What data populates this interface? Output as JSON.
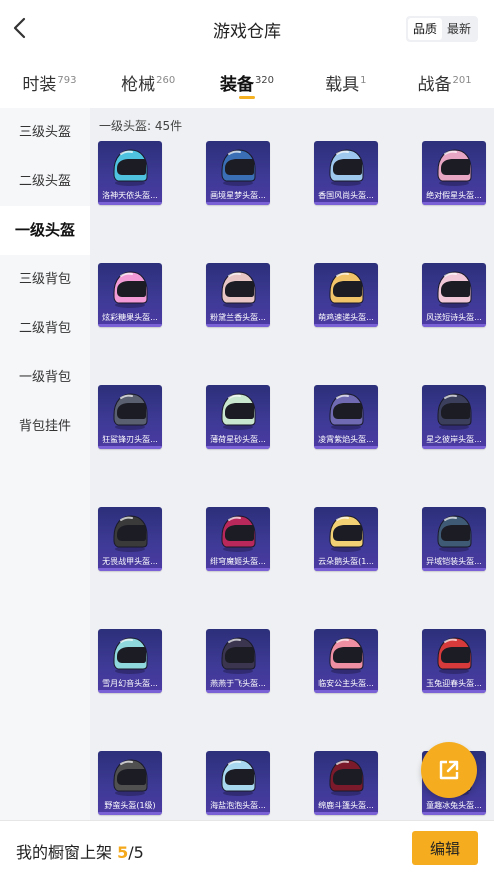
{
  "header": {
    "title": "游戏仓库",
    "sort_options": [
      "品质",
      "最新"
    ],
    "active_sort": "品质"
  },
  "tabs": [
    {
      "label": "时装",
      "count": "793"
    },
    {
      "label": "枪械",
      "count": "260"
    },
    {
      "label": "装备",
      "count": "320"
    },
    {
      "label": "载具",
      "count": "1"
    },
    {
      "label": "战备",
      "count": "201"
    }
  ],
  "sidebar": {
    "items": [
      "三级头盔",
      "二级头盔",
      "一级头盔",
      "三级背包",
      "二级背包",
      "一级背包",
      "背包挂件"
    ]
  },
  "section_title": "一级头盔: 45件",
  "items": [
    {
      "label": "洛神天依头盔...",
      "color": "#4fc2e0"
    },
    {
      "label": "画境星梦头盔...",
      "color": "#3b6fb5"
    },
    {
      "label": "香国风尚头盔...",
      "color": "#9fc8ee"
    },
    {
      "label": "绝对假星头盔...",
      "color": "#e7a7c4"
    },
    {
      "label": "炫彩糖果头盔...",
      "color": "#f29bd7"
    },
    {
      "label": "粉黛兰香头盔...",
      "color": "#e8c6c6"
    },
    {
      "label": "萌鸡速递头盔...",
      "color": "#f2c469"
    },
    {
      "label": "风送短诗头盔...",
      "color": "#f0c8d8"
    },
    {
      "label": "狂鲨锋刃头盔...",
      "color": "#5a6070"
    },
    {
      "label": "薄荷星砂头盔...",
      "color": "#c9e6cf"
    },
    {
      "label": "凌霄紫焰头盔...",
      "color": "#6f6ab2"
    },
    {
      "label": "星之彼岸头盔...",
      "color": "#3c3f5c"
    },
    {
      "label": "无畏战甲头盔...",
      "color": "#3a3a3a"
    },
    {
      "label": "绯穹魔姬头盔...",
      "color": "#b8285a"
    },
    {
      "label": "云朵鹅头盔(1...",
      "color": "#f2d074"
    },
    {
      "label": "异域铠装头盔...",
      "color": "#3f5a74"
    },
    {
      "label": "雪月幻音头盔...",
      "color": "#8fd8de"
    },
    {
      "label": "燕燕于飞头盔...",
      "color": "#3b3550"
    },
    {
      "label": "临安公主头盔...",
      "color": "#ee8fa3"
    },
    {
      "label": "玉兔迎春头盔...",
      "color": "#d63a3a"
    },
    {
      "label": "野蛮头盔(1级)",
      "color": "#505050"
    },
    {
      "label": "海盐泡泡头盔...",
      "color": "#a7d8ef"
    },
    {
      "label": "绵鹿斗篷头盔...",
      "color": "#7a1a2a"
    },
    {
      "label": "童趣冰兔头盔...",
      "color": "#ffffff"
    }
  ],
  "bottom_bar": {
    "label": "我的橱窗上架",
    "count": "5",
    "total": "/5",
    "edit_label": "编辑"
  },
  "colors": {
    "accent": "#f5ad1f",
    "card_bg": "#3d3a95"
  }
}
